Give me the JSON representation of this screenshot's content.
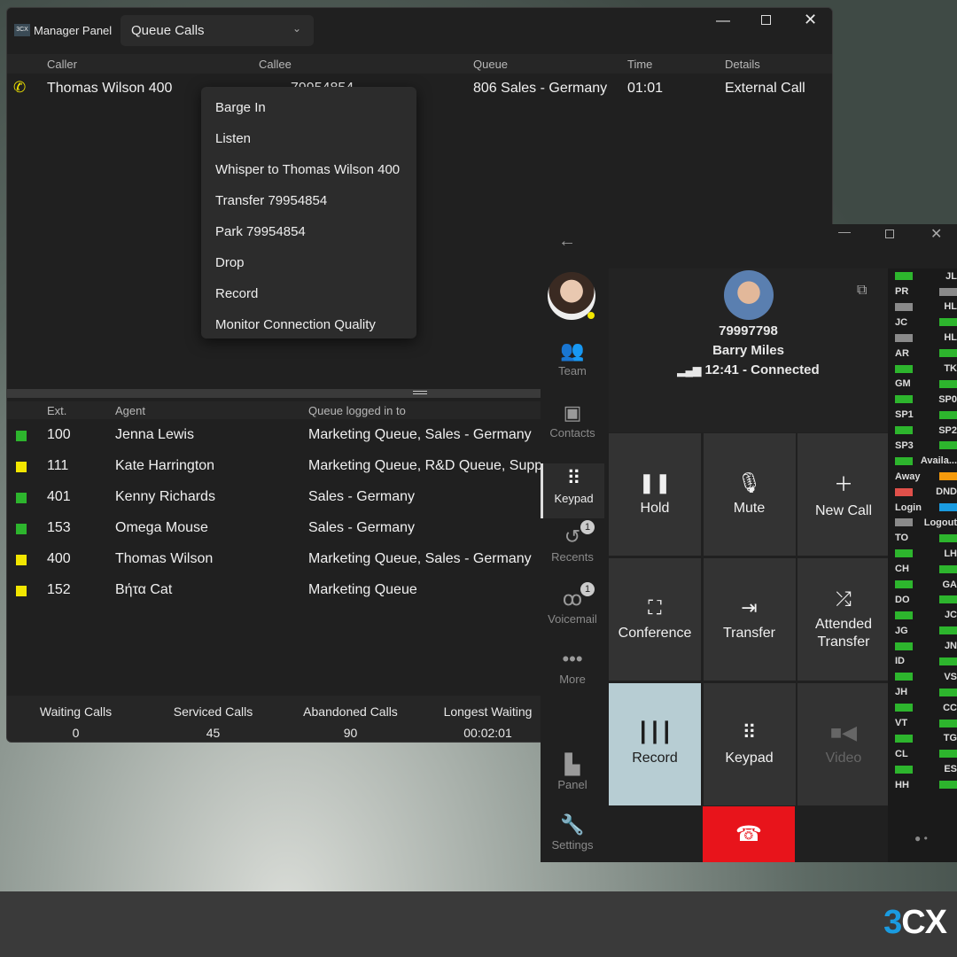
{
  "manager": {
    "app_title": "Manager Panel",
    "logo": "3CX",
    "view_select": "Queue Calls",
    "call_headers": [
      "Caller",
      "Callee",
      "Queue",
      "Time",
      "Details"
    ],
    "call": {
      "caller": "Thomas Wilson 400",
      "callee": "79954854",
      "queue": "806 Sales - Germany",
      "time": "01:01",
      "details": "External Call"
    },
    "context_menu": [
      "Barge In",
      "Listen",
      "Whisper to Thomas Wilson 400",
      "Transfer 79954854",
      "Park 79954854",
      "Drop",
      "Record",
      "Monitor Connection Quality"
    ],
    "agent_headers": [
      "Ext.",
      "Agent",
      "Queue logged in to"
    ],
    "agents": [
      {
        "ext": "100",
        "name": "Jenna Lewis",
        "queues": "Marketing Queue, Sales - Germany",
        "status": "#2db52d"
      },
      {
        "ext": "111",
        "name": "Kate Harrington",
        "queues": "Marketing Queue, R&D Queue, Supp",
        "status": "#f2e600"
      },
      {
        "ext": "401",
        "name": "Kenny Richards",
        "queues": "Sales - Germany",
        "status": "#2db52d"
      },
      {
        "ext": "153",
        "name": "Omega Mouse",
        "queues": "Sales - Germany",
        "status": "#2db52d"
      },
      {
        "ext": "400",
        "name": "Thomas Wilson",
        "queues": "Marketing Queue, Sales - Germany",
        "status": "#f2e600"
      },
      {
        "ext": "152",
        "name": "Βήτα Cat",
        "queues": "Marketing Queue",
        "status": "#f2e600"
      }
    ],
    "stats": [
      {
        "label": "Waiting Calls",
        "value": "0"
      },
      {
        "label": "Serviced Calls",
        "value": "45"
      },
      {
        "label": "Abandoned Calls",
        "value": "90"
      },
      {
        "label": "Longest Waiting",
        "value": "00:02:01"
      }
    ]
  },
  "phone": {
    "nav": [
      {
        "label": "Team",
        "icon": "team-icon"
      },
      {
        "label": "Contacts",
        "icon": "contacts-icon"
      },
      {
        "label": "Keypad",
        "icon": "keypad-icon",
        "active": true
      },
      {
        "label": "Recents",
        "icon": "recents-icon",
        "badge": "1"
      },
      {
        "label": "Voicemail",
        "icon": "voicemail-icon",
        "badge": "1"
      },
      {
        "label": "More",
        "icon": "more-icon"
      },
      {
        "label": "Panel",
        "icon": "panel-icon"
      },
      {
        "label": "Settings",
        "icon": "settings-icon"
      }
    ],
    "call": {
      "number": "79997798",
      "name": "Barry Miles",
      "status": "12:41 - Connected"
    },
    "buttons": [
      {
        "label": "Hold",
        "icon": "pause-icon"
      },
      {
        "label": "Mute",
        "icon": "microphone-icon"
      },
      {
        "label": "New Call",
        "icon": "plus-icon"
      },
      {
        "label": "Conference",
        "icon": "conference-icon"
      },
      {
        "label": "Transfer",
        "icon": "transfer-icon"
      },
      {
        "label": "Attended Transfer",
        "icon": "attended-transfer-icon"
      },
      {
        "label": "Record",
        "icon": "record-icon",
        "active": true
      },
      {
        "label": "Keypad",
        "icon": "keypad-icon"
      },
      {
        "label": "Video",
        "icon": "video-icon",
        "disabled": true
      }
    ],
    "hangup_color": "#e8141b",
    "blf_left": [
      [
        "box",
        "#2db52d"
      ],
      [
        "PR"
      ],
      [
        "box",
        "#8a8a8a"
      ],
      [
        "JC"
      ],
      [
        "box",
        "#8a8a8a"
      ],
      [
        "AR"
      ],
      [
        "box",
        "#2db52d"
      ],
      [
        "GM"
      ],
      [
        "box",
        "#2db52d"
      ],
      [
        "SP1"
      ],
      [
        "box",
        "#2db52d"
      ],
      [
        "SP3"
      ],
      [
        "box",
        "#2db52d"
      ],
      [
        "Away"
      ],
      [
        "box",
        "#e0504a"
      ],
      [
        "Login"
      ],
      [
        "box",
        "#8a8a8a"
      ],
      [
        "TO"
      ],
      [
        "box",
        "#2db52d"
      ],
      [
        "CH"
      ],
      [
        "box",
        "#2db52d"
      ],
      [
        "DO"
      ],
      [
        "box",
        "#2db52d"
      ],
      [
        "JG"
      ],
      [
        "box",
        "#2db52d"
      ],
      [
        "ID"
      ],
      [
        "box",
        "#2db52d"
      ],
      [
        "JH"
      ],
      [
        "box",
        "#2db52d"
      ],
      [
        "VT"
      ],
      [
        "box",
        "#2db52d"
      ],
      [
        "CL"
      ],
      [
        "box",
        "#2db52d"
      ],
      [
        "HH"
      ]
    ],
    "blf_right": [
      [
        "JL"
      ],
      [
        "box",
        "#8a8a8a"
      ],
      [
        "HL"
      ],
      [
        "box",
        "#2db52d"
      ],
      [
        "HL"
      ],
      [
        "box",
        "#2db52d"
      ],
      [
        "TK"
      ],
      [
        "box",
        "#2db52d"
      ],
      [
        "SP0"
      ],
      [
        "box",
        "#2db52d"
      ],
      [
        "SP2"
      ],
      [
        "box",
        "#2db52d"
      ],
      [
        "Availa..."
      ],
      [
        "box",
        "#f59a0c"
      ],
      [
        "DND"
      ],
      [
        "box",
        "#1a9be0"
      ],
      [
        "Logout"
      ],
      [
        "box",
        "#2db52d"
      ],
      [
        "LH"
      ],
      [
        "box",
        "#2db52d"
      ],
      [
        "GA"
      ],
      [
        "box",
        "#2db52d"
      ],
      [
        "JC"
      ],
      [
        "box",
        "#2db52d"
      ],
      [
        "JN"
      ],
      [
        "box",
        "#2db52d"
      ],
      [
        "VS"
      ],
      [
        "box",
        "#2db52d"
      ],
      [
        "CC"
      ],
      [
        "box",
        "#2db52d"
      ],
      [
        "TG"
      ],
      [
        "box",
        "#2db52d"
      ],
      [
        "ES"
      ],
      [
        "box",
        "#2db52d"
      ]
    ]
  },
  "brand": {
    "logo": "3CX"
  }
}
